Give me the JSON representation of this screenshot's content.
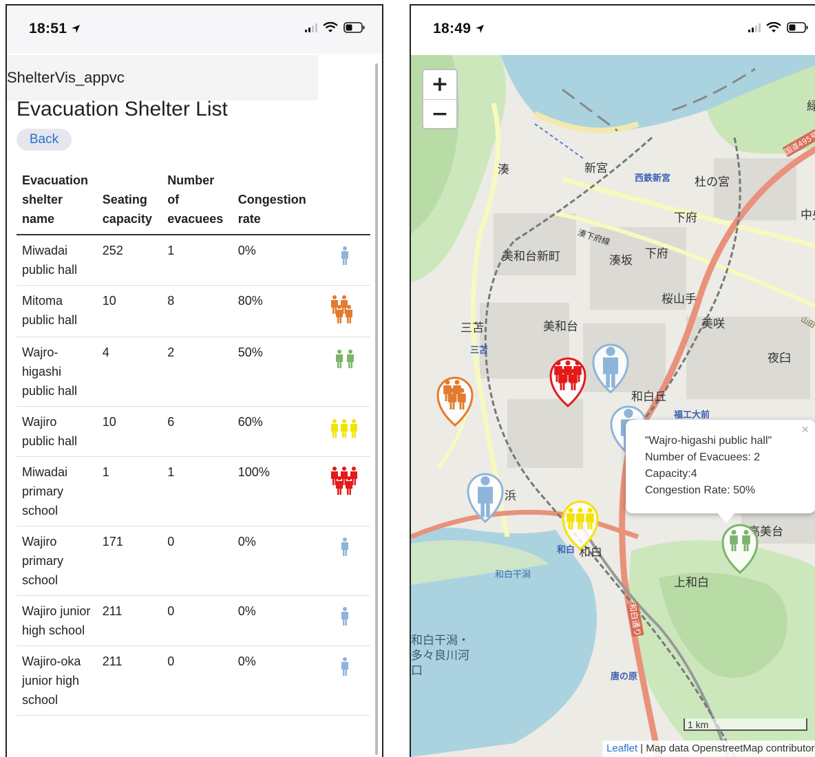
{
  "left_screen": {
    "status_time": "18:51",
    "app_name": "ShelterVis_appvc",
    "page_title": "Evacuation Shelter List",
    "back_label": "Back",
    "table": {
      "headers": [
        "Evacuation shelter name",
        "Seating capacity",
        "Number of evacuees",
        "Congestion rate"
      ],
      "rows": [
        {
          "name": "Miwadai public hall",
          "capacity": "252",
          "evacuees": "1",
          "rate": "0%",
          "icon": "person-icon",
          "count": 1,
          "color": "#8fb4da"
        },
        {
          "name": "Mitoma public hall",
          "capacity": "10",
          "evacuees": "8",
          "rate": "80%",
          "icon": "crowd-icon",
          "count": 4,
          "color": "#e37b2e"
        },
        {
          "name": "Wajro-higashi public hall",
          "capacity": "4",
          "evacuees": "2",
          "rate": "50%",
          "icon": "crowd-icon",
          "count": 2,
          "color": "#7ab56a"
        },
        {
          "name": "Wajiro public hall",
          "capacity": "10",
          "evacuees": "6",
          "rate": "60%",
          "icon": "crowd-icon",
          "count": 3,
          "color": "#f2e300"
        },
        {
          "name": "Miwadai primary school",
          "capacity": "1",
          "evacuees": "1",
          "rate": "100%",
          "icon": "crowd-icon",
          "count": 5,
          "color": "#e41919"
        },
        {
          "name": "Wajiro primary school",
          "capacity": "171",
          "evacuees": "0",
          "rate": "0%",
          "icon": "person-icon",
          "count": 1,
          "color": "#8fb4da"
        },
        {
          "name": "Wajiro junior high school",
          "capacity": "211",
          "evacuees": "0",
          "rate": "0%",
          "icon": "person-icon",
          "count": 1,
          "color": "#8fb4da"
        },
        {
          "name": "Wajiro-oka junior high school",
          "capacity": "211",
          "evacuees": "0",
          "rate": "0%",
          "icon": "person-icon",
          "count": 1,
          "color": "#8fb4da"
        }
      ]
    }
  },
  "right_screen": {
    "status_time": "18:49",
    "zoom_in": "+",
    "zoom_out": "−",
    "places": [
      "緑",
      "新宮",
      "西鉄新宮",
      "杜の宮",
      "下府",
      "中央",
      "湊",
      "湊下府線",
      "美和台新町",
      "湊坂",
      "下府",
      "桜山手",
      "美咲",
      "三苫",
      "三苫",
      "美和台",
      "夜臼",
      "和白丘",
      "福工大前",
      "浜",
      "高美台",
      "和白",
      "和白",
      "上和白",
      "和白干潟",
      "和白干潟・多々良川河口",
      "唐の原",
      "国道495号",
      "山田",
      "和白通り"
    ],
    "popup": {
      "title": "\"Wajro-higashi public hall\"",
      "evacuees": "Number of Evacuees: 2",
      "capacity": "Capacity:4",
      "rate": "Congestion Rate: 50%",
      "close": "×"
    },
    "scale": "1 km",
    "attribution_link": "Leaflet",
    "attribution_text": " | Map data OpenstreetMap contributors",
    "colors": {
      "blue": "#8fb4da",
      "orange": "#e37b2e",
      "green": "#7ab56a",
      "yellow": "#f2e300",
      "red": "#e41919"
    }
  }
}
